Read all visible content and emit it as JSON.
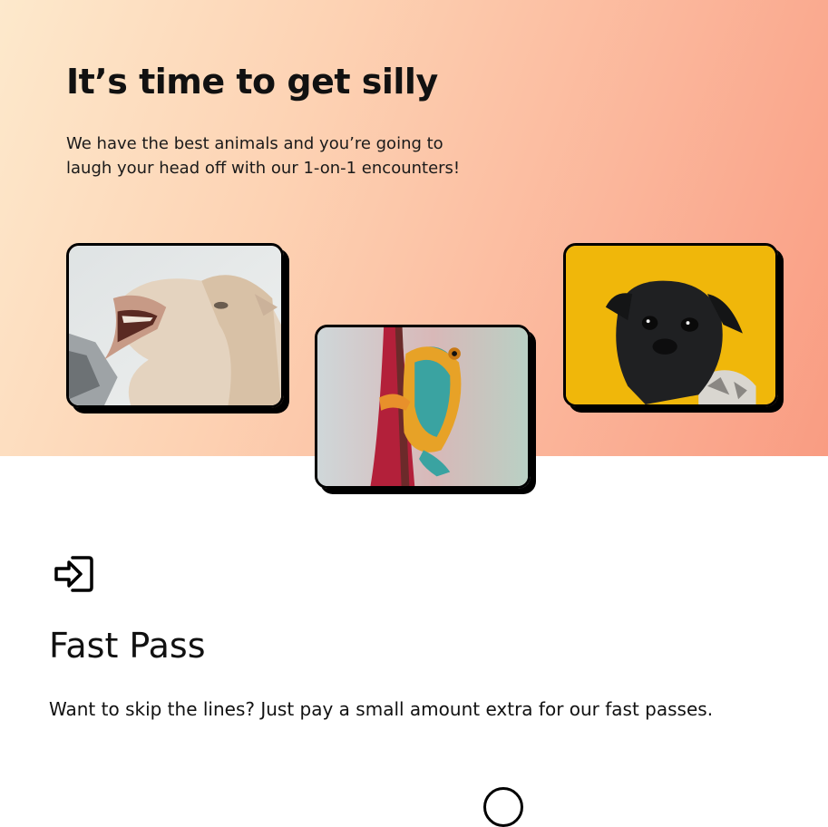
{
  "hero": {
    "title": "It’s time to get silly",
    "description": "We have the best animals and you’re going to laugh your head off with our 1-on-1 encounters!",
    "gradient_start": "#fde9cc",
    "gradient_end": "#f99c82",
    "images": [
      {
        "icon": "laughing-horse-photo"
      },
      {
        "icon": "tree-frog-photo"
      },
      {
        "icon": "pug-photo"
      }
    ]
  },
  "feature": {
    "icon": "login-arrow-icon",
    "title": "Fast Pass",
    "description": "Want to skip the lines? Just pay a small amount extra for our fast passes."
  },
  "next_feature": {
    "icon": "circle-icon"
  }
}
